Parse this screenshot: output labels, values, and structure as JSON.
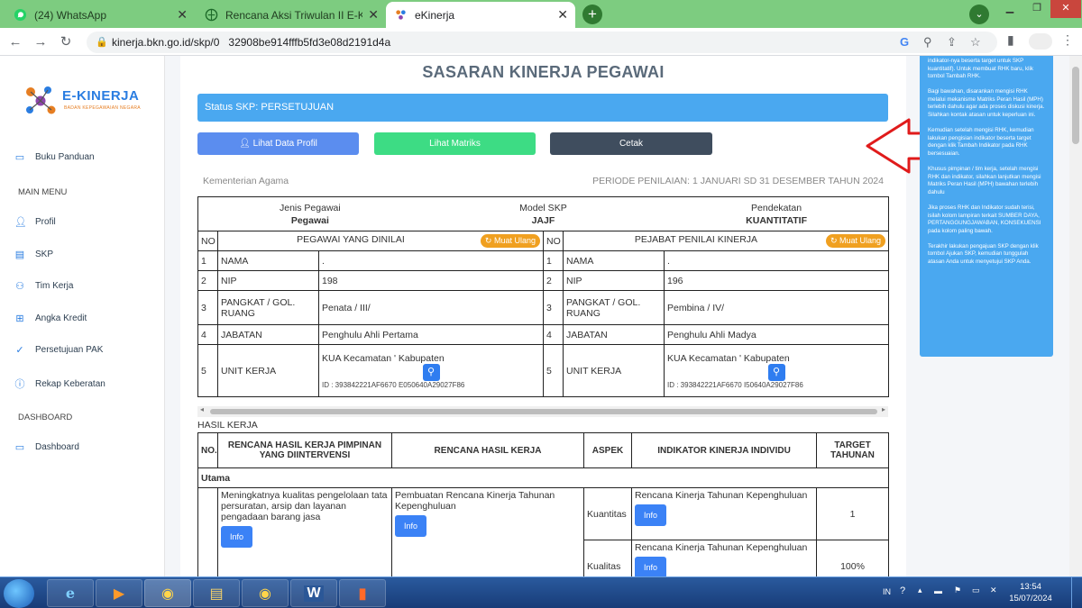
{
  "browser": {
    "tabs": [
      {
        "title": "(24) WhatsApp",
        "icon": "whatsapp-icon"
      },
      {
        "title": "Rencana Aksi Triwulan II E-Kinerja",
        "icon": "globe-icon"
      },
      {
        "title": "eKinerja",
        "icon": "ekinerja-icon"
      }
    ],
    "url": "kinerja.bkn.go.id/skp/0   32908be914fffb5fd3e08d2191d4a"
  },
  "sidebar": {
    "brand": "E-KINERJA",
    "brand_sub": "BADAN KEPEGAWAIAN NEGARA",
    "top_item": "Buku Panduan",
    "main_menu_heading": "MAIN MENU",
    "menu": [
      "Profil",
      "SKP",
      "Tim Kerja",
      "Angka Kredit",
      "Persetujuan PAK",
      "Rekap Keberatan"
    ],
    "dashboard_heading": "DASHBOARD",
    "dashboard_item": "Dashboard"
  },
  "main": {
    "title": "SASARAN KINERJA PEGAWAI",
    "status": "Status SKP: PERSETUJUAN",
    "btn_profil": "Lihat Data Profil",
    "btn_matriks": "Lihat Matriks",
    "btn_cetak": "Cetak",
    "organization": "Kementerian Agama",
    "periode": "PERIODE PENILAIAN: 1 JANUARI SD 31 DESEMBER TAHUN 2024"
  },
  "info": {
    "jenis_label": "Jenis Pegawai",
    "jenis_value": "Pegawai",
    "model_label": "Model SKP",
    "model_value": "JAJF",
    "pendekatan_label": "Pendekatan",
    "pendekatan_value": "KUANTITATIF",
    "no": "NO",
    "pegawai_header": "PEGAWAI YANG DINILAI",
    "pejabat_header": "PEJABAT PENILAI KINERJA",
    "muat_ulang": "Muat Ulang",
    "rows": [
      {
        "no": "1",
        "label": "NAMA",
        "left": ".",
        "right": "."
      },
      {
        "no": "2",
        "label": "NIP",
        "left": "198",
        "right": "196"
      },
      {
        "no": "3",
        "label": "PANGKAT / GOL. RUANG",
        "left": "Penata / III/",
        "right": "Pembina / IV/"
      },
      {
        "no": "4",
        "label": "JABATAN",
        "left": "Penghulu Ahli Pertama",
        "right": "Penghulu Ahli Madya"
      },
      {
        "no": "5",
        "label": "UNIT KERJA",
        "left": "KUA Kecamatan ' Kabupaten",
        "right": "KUA Kecamatan ' Kabupaten"
      }
    ],
    "left_id": "ID : 393842221AF6670 E050640A29027F86",
    "right_id": "ID : 393842221AF6670 I50640A29027F86"
  },
  "hasil": {
    "section": "HASIL KERJA",
    "headers": [
      "NO.",
      "RENCANA HASIL KERJA PIMPINAN YANG DIINTERVENSI",
      "RENCANA HASIL KERJA",
      "ASPEK",
      "INDIKATOR KINERJA INDIVIDU",
      "TARGET TAHUNAN"
    ],
    "group": "Utama",
    "row_no": "1",
    "pimpinan_text": "Meningkatnya kualitas pengelolaan tata persuratan, arsip dan layanan pengadaan barang jasa",
    "rencana_text": "Pembuatan Rencana Kinerja Tahunan Kepenghuluan",
    "info_label": "Info",
    "aspects": [
      {
        "aspek": "Kuantitas",
        "indikator": "Rencana Kinerja Tahunan Kepenghuluan",
        "target": "1"
      },
      {
        "aspek": "Kualitas",
        "indikator": "Rencana Kinerja Tahunan Kepenghuluan",
        "target": "100%"
      }
    ]
  },
  "helper": [
    "indikator-nya beserta target untuk SKP kuantitatif). Untuk membuat RHK baru, klik tombol Tambah RHK.",
    "Bagi bawahan, disarankan mengisi RHK melalui mekanisme Matriks Peran Hasil (MPH) terlebih dahulu agar ada proses diskusi kinerja. Silahkan kontak atasan untuk keperluan ini.",
    "Kemudian setelah mengisi RHK, kemudian lakukan pengisian indikator beserta target dengan klik Tambah Indikator pada RHK bersesuaian.",
    "Khusus pimpinan / tim kerja, setelah mengisi RHK dan indikator, silahkan lanjutkan mengisi Matriks Peran Hasil (MPH) bawahan terlebih dahulu",
    "Jika proses RHK dan Indikator sudah terisi, isilah kolom lampiran terkait SUMBER DAYA, PERTANGGUNGJAWABAN, KONSEKUENSI pada kolom paling bawah.",
    "Terakhir lakukan pengajuan SKP dengan klik tombol Ajukan SKP, kemudian tunggulah atasan Anda untuk menyetujui SKP Anda."
  ],
  "taskbar": {
    "lang": "IN",
    "time": "13:54",
    "date": "15/07/2024"
  }
}
